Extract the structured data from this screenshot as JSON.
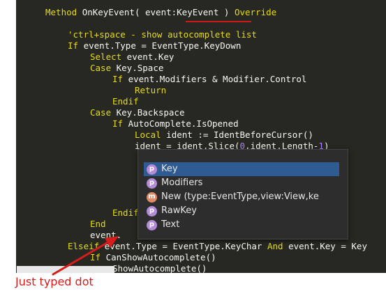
{
  "code_lines": [
    {
      "parts": [
        {
          "t": "Method ",
          "c": "kw"
        },
        {
          "t": "OnKeyEvent( event:KeyEvent ) ",
          "c": ""
        },
        {
          "t": "Override",
          "c": "kw"
        }
      ]
    },
    {
      "parts": []
    },
    {
      "parts": [
        {
          "t": "'ctrl+space - show autocomplete list",
          "c": "cm"
        }
      ]
    },
    {
      "parts": [
        {
          "t": "If",
          "c": "kw"
        },
        {
          "t": " event.Type = EventType.KeyDown",
          "c": ""
        }
      ]
    },
    {
      "parts": [
        {
          "t": "Select",
          "c": "kw"
        },
        {
          "t": " event.Key",
          "c": ""
        }
      ]
    },
    {
      "parts": [
        {
          "t": "Case",
          "c": "kw"
        },
        {
          "t": " Key.Space",
          "c": ""
        }
      ]
    },
    {
      "parts": [
        {
          "t": "If",
          "c": "kw"
        },
        {
          "t": " event.Modifiers & Modifier.Control",
          "c": ""
        }
      ]
    },
    {
      "parts": [
        {
          "t": "Return",
          "c": "kw"
        }
      ]
    },
    {
      "parts": [
        {
          "t": "Endif",
          "c": "kw"
        }
      ]
    },
    {
      "parts": [
        {
          "t": "Case",
          "c": "kw"
        },
        {
          "t": " Key.Backspace",
          "c": ""
        }
      ]
    },
    {
      "parts": [
        {
          "t": "If",
          "c": "kw"
        },
        {
          "t": " AutoComplete.IsOpened",
          "c": ""
        }
      ]
    },
    {
      "parts": [
        {
          "t": "Local",
          "c": "kw"
        },
        {
          "t": " ident := IdentBeforeCursor()",
          "c": ""
        }
      ]
    },
    {
      "parts": [
        {
          "t": "ident = ident.Slice(",
          "c": ""
        },
        {
          "t": "0",
          "c": "num"
        },
        {
          "t": ",ident.Length-",
          "c": ""
        },
        {
          "t": "1",
          "c": "num"
        },
        {
          "t": ")",
          "c": ""
        }
      ]
    },
    {
      "parts": []
    },
    {
      "parts": []
    },
    {
      "parts": []
    },
    {
      "parts": []
    },
    {
      "parts": []
    },
    {
      "parts": [
        {
          "t": "Endif",
          "c": "kw"
        }
      ]
    },
    {
      "parts": [
        {
          "t": "End",
          "c": "kw"
        }
      ]
    },
    {
      "parts": [
        {
          "t": "event.",
          "c": ""
        }
      ]
    },
    {
      "parts": [
        {
          "t": "Elseif",
          "c": "kw"
        },
        {
          "t": " event.Type = EventType.KeyChar ",
          "c": ""
        },
        {
          "t": "And",
          "c": "kw"
        },
        {
          "t": " event.Key = Key",
          "c": ""
        }
      ]
    },
    {
      "parts": [
        {
          "t": "If",
          "c": "kw"
        },
        {
          "t": " CanShowAutocomplete()",
          "c": ""
        }
      ]
    },
    {
      "parts": [
        {
          "t": "ShowAutocomplete()",
          "c": ""
        }
      ]
    }
  ],
  "autocomplete": {
    "items": [
      {
        "badge": "p",
        "kind": "property",
        "label": "Key",
        "selected": true
      },
      {
        "badge": "p",
        "kind": "property",
        "label": "Modifiers",
        "selected": false
      },
      {
        "badge": "m",
        "kind": "method",
        "label": "New (type:EventType,view:View,ke",
        "selected": false
      },
      {
        "badge": "p",
        "kind": "property",
        "label": "RawKey",
        "selected": false
      },
      {
        "badge": "p",
        "kind": "property",
        "label": "Text",
        "selected": false
      }
    ]
  },
  "annotation": {
    "text": "Just typed dot",
    "color": "#d81b1b"
  },
  "colors": {
    "editor_bg": "#272822",
    "keyword": "#e6db19",
    "text": "#f8f8f2",
    "selection": "#2f5b93"
  }
}
